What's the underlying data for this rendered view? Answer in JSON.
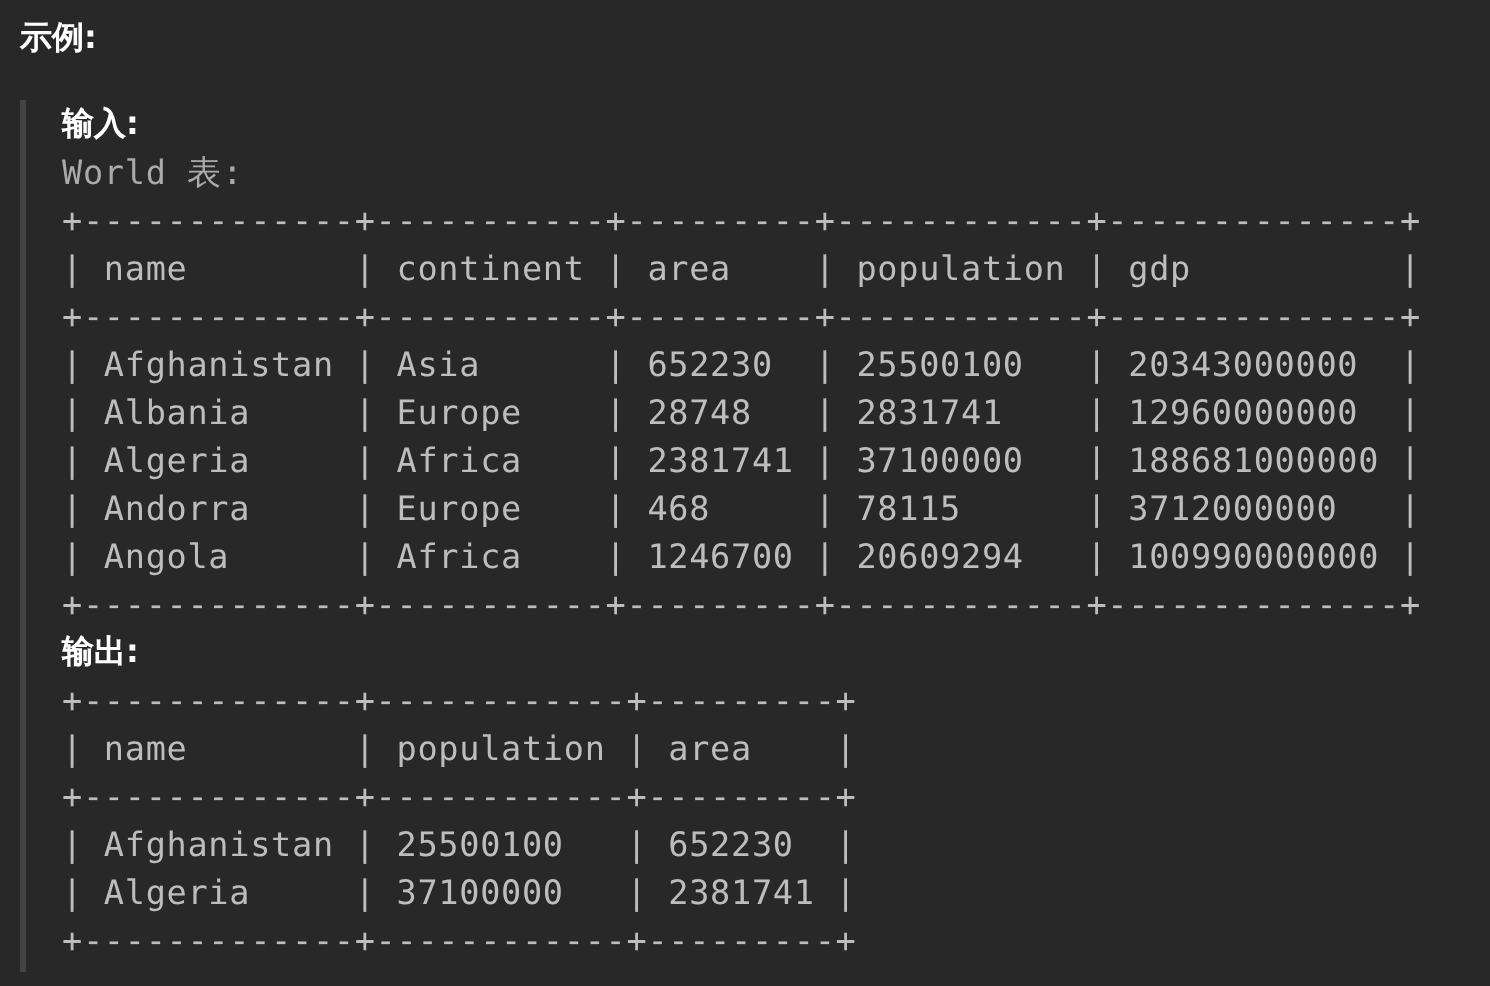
{
  "heading": "示例:",
  "input": {
    "label": "输入:",
    "caption": "World 表:",
    "lines": [
      "+-------------+-----------+---------+------------+--------------+",
      "| name        | continent | area    | population | gdp          |",
      "+-------------+-----------+---------+------------+--------------+",
      "| Afghanistan | Asia      | 652230  | 25500100   | 20343000000  |",
      "| Albania     | Europe    | 28748   | 2831741    | 12960000000  |",
      "| Algeria     | Africa    | 2381741 | 37100000   | 188681000000 |",
      "| Andorra     | Europe    | 468     | 78115      | 3712000000   |",
      "| Angola      | Africa    | 1246700 | 20609294   | 100990000000 |",
      "+-------------+-----------+---------+------------+--------------+"
    ]
  },
  "output": {
    "label": "输出:",
    "lines": [
      "+-------------+------------+---------+",
      "| name        | population | area    |",
      "+-------------+------------+---------+",
      "| Afghanistan | 25500100   | 652230  |",
      "| Algeria     | 37100000   | 2381741 |",
      "+-------------+------------+---------+"
    ]
  }
}
